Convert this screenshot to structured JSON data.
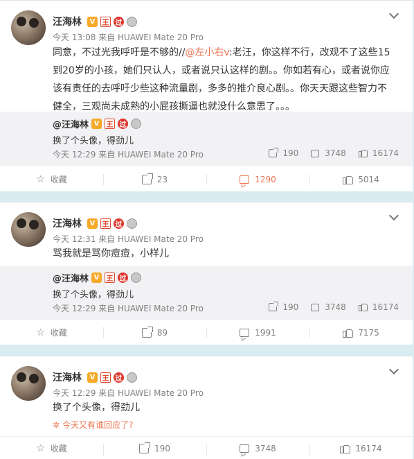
{
  "posts": [
    {
      "author": "汪海林",
      "meta": "今天 13:08 来自 HUAWEI Mate 20 Pro",
      "text_before": "同意，不过光我呼吁是不够的//",
      "mention": "@左小右v",
      "text_after": ":老汪，你这样不行，改观不了这些15到20岁的小孩，她们只认人，或者说只认这样的剧。。你如若有心，或者说你应该有责任的去呼吁少些这种流量剧，多多的推介良心剧。。你天天跟这些智力不健全，三观尚未成熟的小屁孩撕逼也就没什么意思了。。。",
      "repost": {
        "author": "@汪海林",
        "text": "换了个头像，得劲儿",
        "meta": "今天 12:29 来自 HUAWEI Mate 20 Pro",
        "shares": "190",
        "comments": "3748",
        "likes": "16174"
      },
      "actions": {
        "favorite": "收藏",
        "share": "23",
        "comment": "1290",
        "like": "5014"
      }
    },
    {
      "author": "汪海林",
      "meta": "今天 12:31 来自 HUAWEI Mate 20 Pro",
      "text": "骂我就是骂你痘痘，小样儿",
      "repost": {
        "author": "@汪海林",
        "text": "换了个头像，得劲儿",
        "meta": "今天 12:29 来自 HUAWEI Mate 20 Pro",
        "shares": "190",
        "comments": "3748",
        "likes": "16174"
      },
      "actions": {
        "favorite": "收藏",
        "share": "89",
        "comment": "1991",
        "like": "7175"
      }
    },
    {
      "author": "汪海林",
      "meta": "今天 12:29 来自 HUAWEI Mate 20 Pro",
      "text": "换了个头像，得劲儿",
      "hint": "今天又有谁回应了?",
      "actions": {
        "favorite": "收藏",
        "share": "190",
        "comment": "3748",
        "like": "16174"
      }
    }
  ],
  "badges": {
    "verified": "V",
    "flag": "王",
    "circle": "过"
  },
  "colors": {
    "background": "#d9ecf1",
    "accent": "#eb7350",
    "verified": "#f7a928"
  }
}
